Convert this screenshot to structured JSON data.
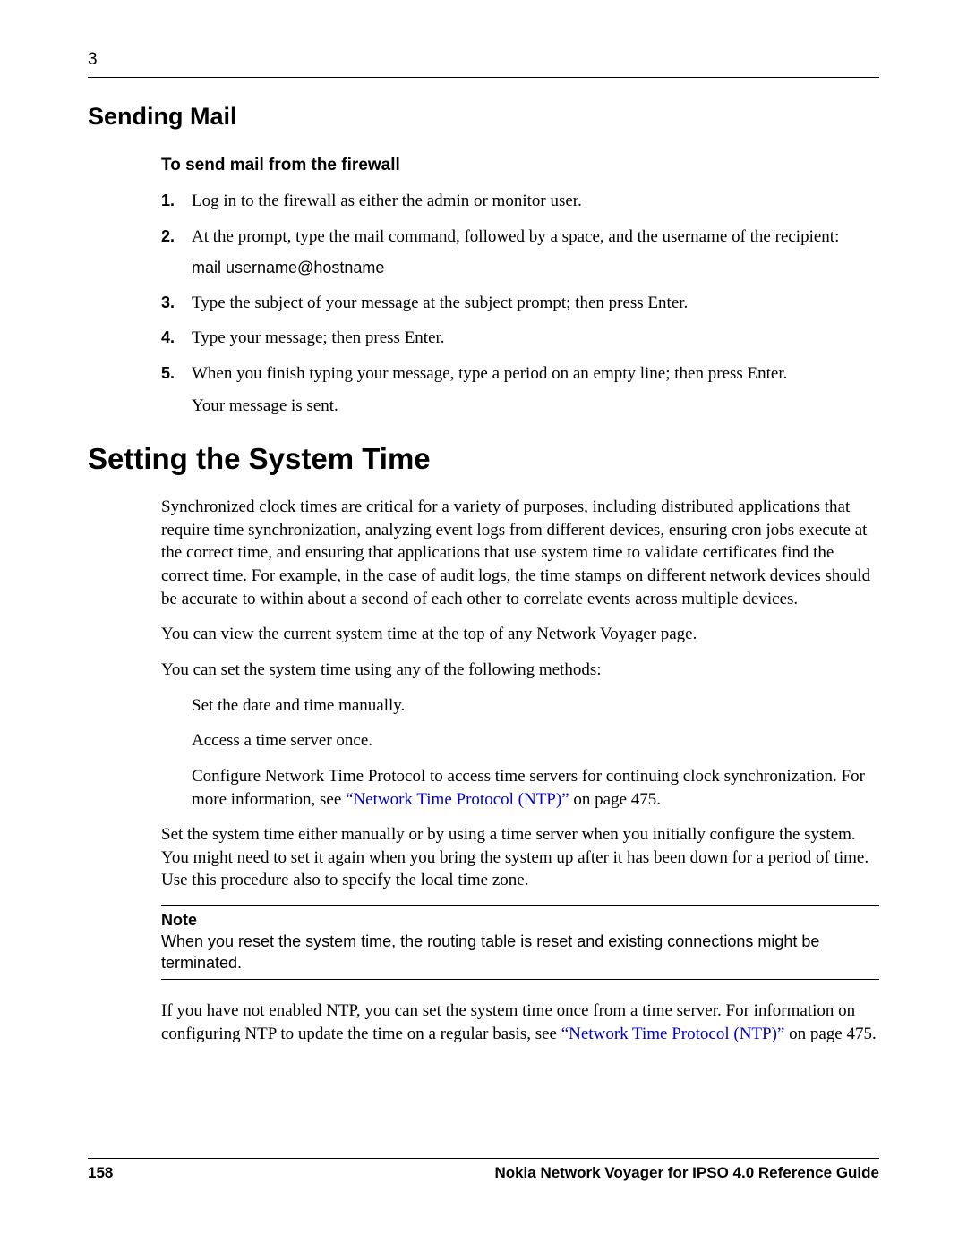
{
  "chapter_number": "3",
  "section1_heading": "Sending Mail",
  "sub_heading": "To send mail from the firewall",
  "steps": {
    "s1": {
      "num": "1.",
      "text": "Log in to the firewall as either the admin or monitor user."
    },
    "s2": {
      "num": "2.",
      "text": "At the prompt, type the mail command, followed by a space, and the username of the recipient:",
      "code": "mail username@hostname"
    },
    "s3": {
      "num": "3.",
      "text": "Type the subject of your message at the subject prompt; then press Enter."
    },
    "s4": {
      "num": "4.",
      "text": "Type your message; then press Enter."
    },
    "s5": {
      "num": "5.",
      "text": "When you finish typing your message, type a period on an empty line; then press Enter.",
      "followup": "Your message is sent."
    }
  },
  "section2_heading": "Setting the System Time",
  "para1": "Synchronized clock times are critical for a variety of purposes, including distributed applications that require time synchronization, analyzing event logs from different devices, ensuring cron jobs execute at the correct time, and ensuring that applications that use system time to validate certificates find the correct time. For example, in the case of audit logs, the time stamps on different network devices should be accurate to within about a second of each other to correlate events across multiple devices.",
  "para2": "You can view the current system time at the top of any Network Voyager page.",
  "para3": "You can set the system time using any of the following methods:",
  "methods": {
    "m1": "Set the date and time manually.",
    "m2": "Access a time server once.",
    "m3_pre": "Configure Network Time Protocol to access time servers for continuing clock synchronization. For more information, see ",
    "m3_link": "“Network Time Protocol (NTP)”",
    "m3_post": " on page 475."
  },
  "para4": "Set the system time either manually or by using a time server when you initially configure the system. You might need to set it again when you bring the system up after it has been down for a period of time. Use this procedure also to specify the local time zone.",
  "note_label": "Note",
  "note_text": "When you reset the system time, the routing table is reset and existing connections might be terminated.",
  "para5_pre": "If you have not enabled NTP, you can set the system time once from a time server. For information on configuring NTP to update the time on a regular basis, see ",
  "para5_link": "“Network Time Protocol (NTP)”",
  "para5_post": " on page 475.",
  "footer_page": "158",
  "footer_title": "Nokia Network Voyager for IPSO 4.0 Reference Guide"
}
